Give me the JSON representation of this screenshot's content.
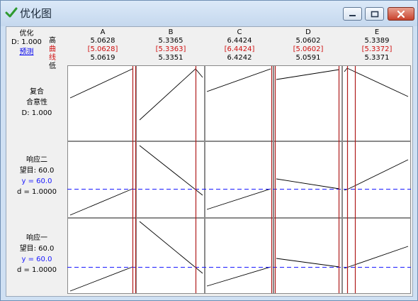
{
  "window": {
    "title": "优化图"
  },
  "summary": {
    "label": "优化",
    "desirability": "D: 1.000",
    "predict_link": "预测",
    "row_high": "高",
    "row_cur": "曲线",
    "row_low": "低"
  },
  "factors": [
    {
      "name": "A",
      "high": "5.0628",
      "cur": "[5.0628]",
      "low": "5.0619"
    },
    {
      "name": "B",
      "high": "5.3365",
      "cur": "[5.3363]",
      "low": "5.3351"
    },
    {
      "name": "C",
      "high": "6.4424",
      "cur": "[6.4424]",
      "low": "6.4242"
    },
    {
      "name": "D",
      "high": "5.0602",
      "cur": "[5.0602]",
      "low": "5.0591"
    },
    {
      "name": "E",
      "high": "5.3389",
      "cur": "[5.3372]",
      "low": "5.3371"
    }
  ],
  "responses": [
    {
      "line1": "复合",
      "line2": "合意性",
      "line3": "D: 1.000",
      "line4": ""
    },
    {
      "line1": "响应二",
      "line2": "望目: 60.0",
      "line3": "y = 60.0",
      "line4": "d = 1.0000"
    },
    {
      "line1": "响应一",
      "line2": "望目: 60.0",
      "line3": "y = 60.0",
      "line4": "d = 1.0000"
    }
  ],
  "colors": {
    "cursor_line": "#b01c1c",
    "target_line": "#1a1aff",
    "trace": "#000000"
  }
}
